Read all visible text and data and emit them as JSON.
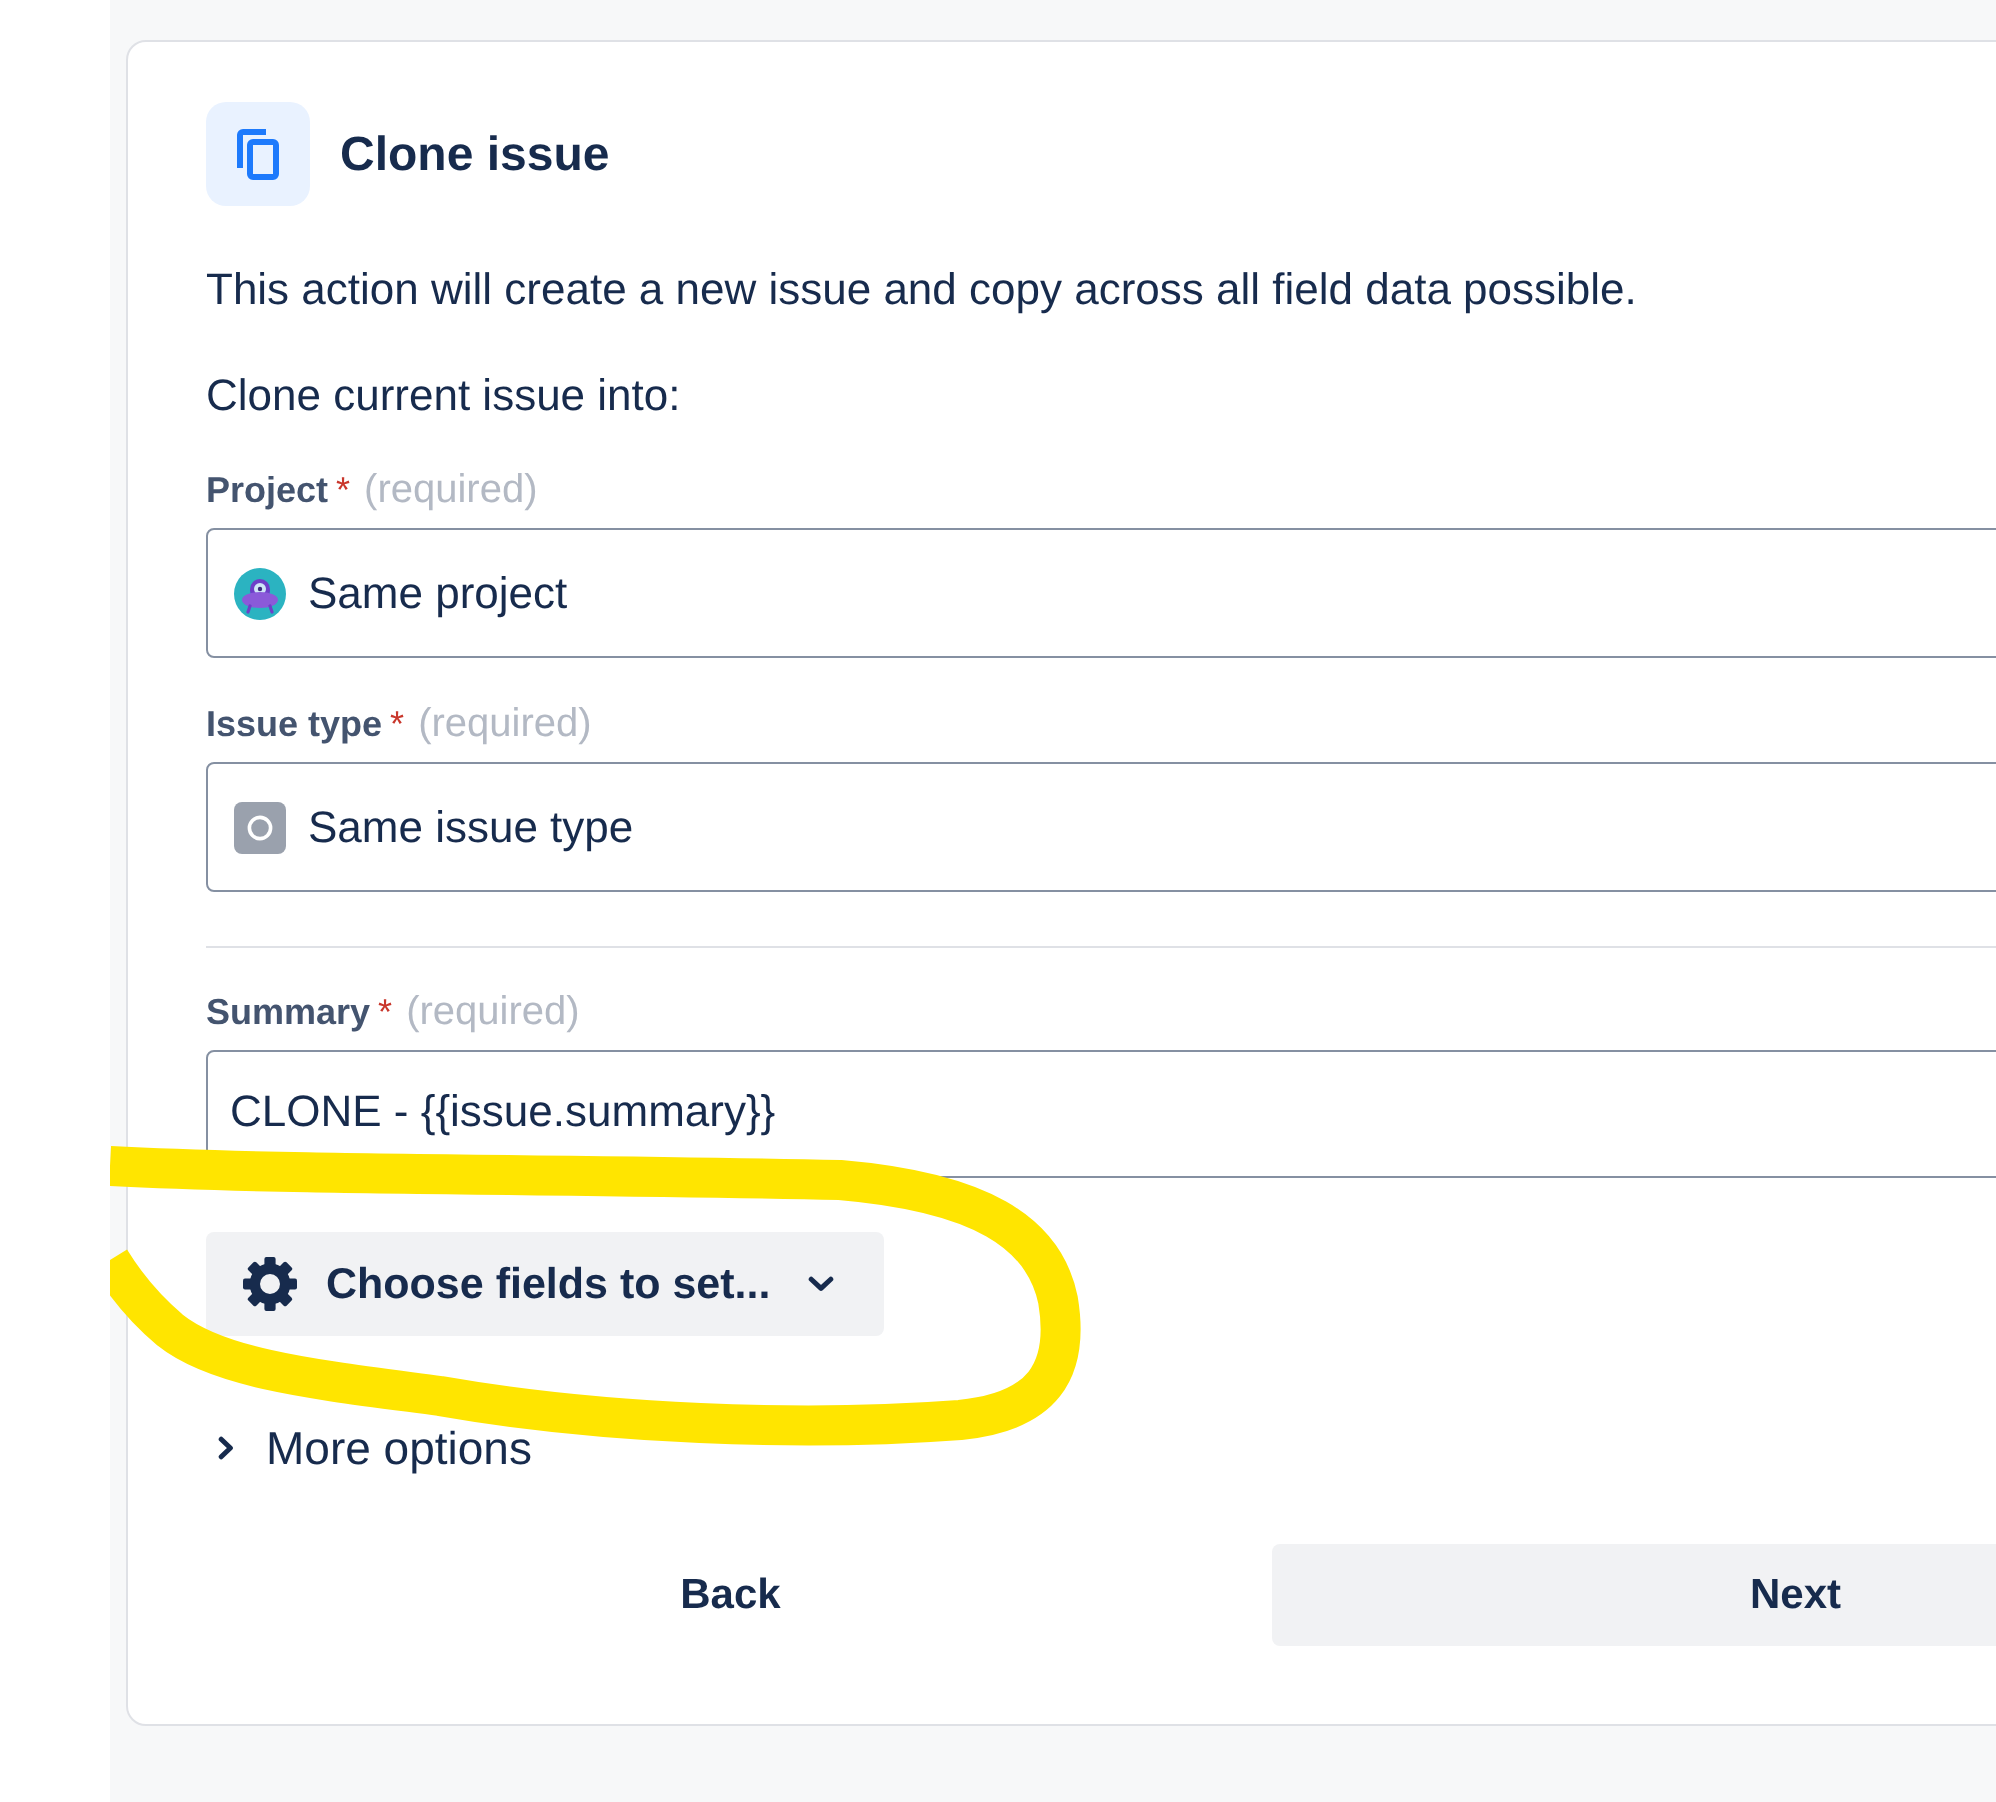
{
  "card": {
    "title": "Clone issue",
    "description": "This action will create a new issue and copy across all field data possible.",
    "intro": "Clone current issue into:"
  },
  "selects": [
    {
      "kind": "project",
      "label": "Project",
      "required_mark": "*",
      "required_note": "(required)",
      "value": "Same project"
    },
    {
      "kind": "issuetype",
      "label": "Issue type",
      "required_mark": "*",
      "required_note": "(required)",
      "value": "Same issue type"
    }
  ],
  "summary": {
    "label": "Summary",
    "required_mark": "*",
    "required_note": "(required)",
    "value": "CLONE - {{issue.summary}}"
  },
  "choose_fields": {
    "label": "Choose fields to set..."
  },
  "more_options": {
    "label": "More options",
    "expanded": false
  },
  "buttons": [
    {
      "kind": "subtle",
      "label": "Back"
    },
    {
      "kind": "default",
      "label": "Next"
    }
  ]
}
